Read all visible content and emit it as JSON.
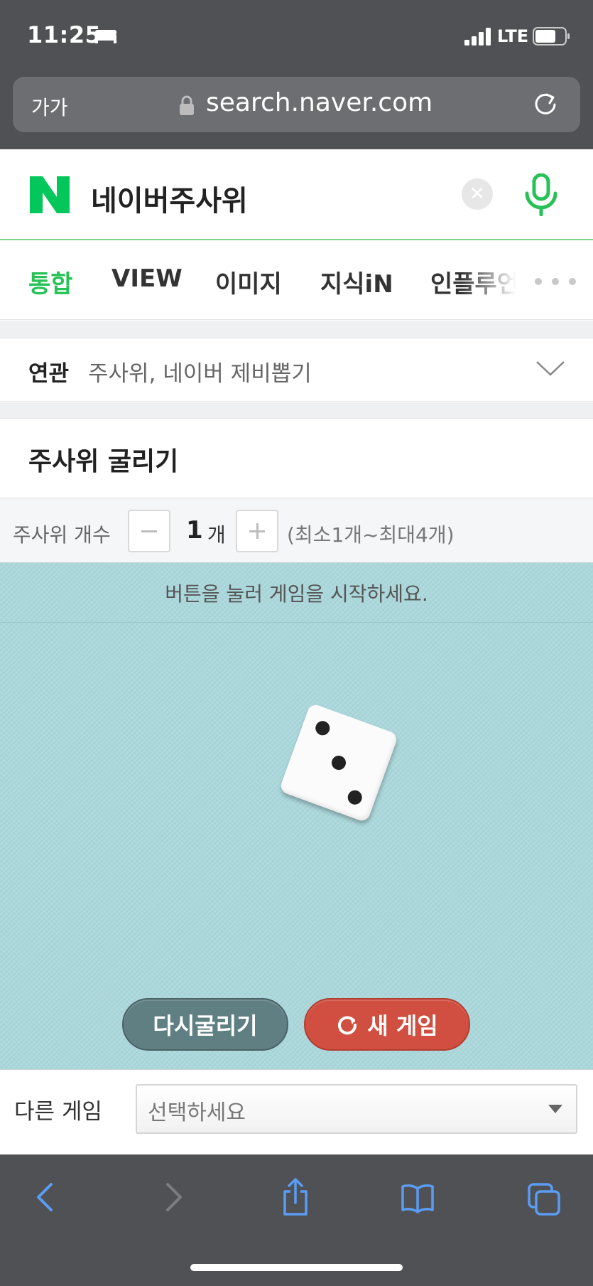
{
  "status_bar": {
    "time": "11:25",
    "network": "LTE",
    "icons": [
      "bed-icon",
      "signal-icon",
      "battery-icon"
    ]
  },
  "browser": {
    "text_size_label": "가가",
    "url": "search.naver.com",
    "icons": [
      "lock-icon",
      "reload-icon"
    ]
  },
  "search": {
    "query": "네이버주사위",
    "logo_color": "#03c75a",
    "icons": [
      "naver-logo-icon",
      "clear-icon",
      "mic-icon"
    ]
  },
  "tabs": [
    {
      "label": "통합",
      "active": true
    },
    {
      "label": "VIEW"
    },
    {
      "label": "이미지"
    },
    {
      "label": "지식iN"
    },
    {
      "label": "인플루언"
    }
  ],
  "related": {
    "label": "연관",
    "text": "주사위, 네이버 제비뽑기"
  },
  "dice_game": {
    "title": "주사위 굴리기",
    "count_label": "주사위 개수",
    "count_value": "1",
    "count_unit": "개",
    "count_range": "(최소1개~최대4개)",
    "message": "버튼을 눌러 게임을 시작하세요.",
    "dice_face_value": 3,
    "reroll_label": "다시굴리기",
    "new_game_label": "새 게임",
    "board_color": "#abd8dc",
    "reroll_color": "#5f7f83",
    "new_game_color": "#d14f40"
  },
  "other_games": {
    "label": "다른 게임",
    "select_value": "선택하세요"
  },
  "toolbar": {
    "icons": [
      "back-icon",
      "forward-icon",
      "share-icon",
      "bookmarks-icon",
      "tabs-icon"
    ]
  }
}
